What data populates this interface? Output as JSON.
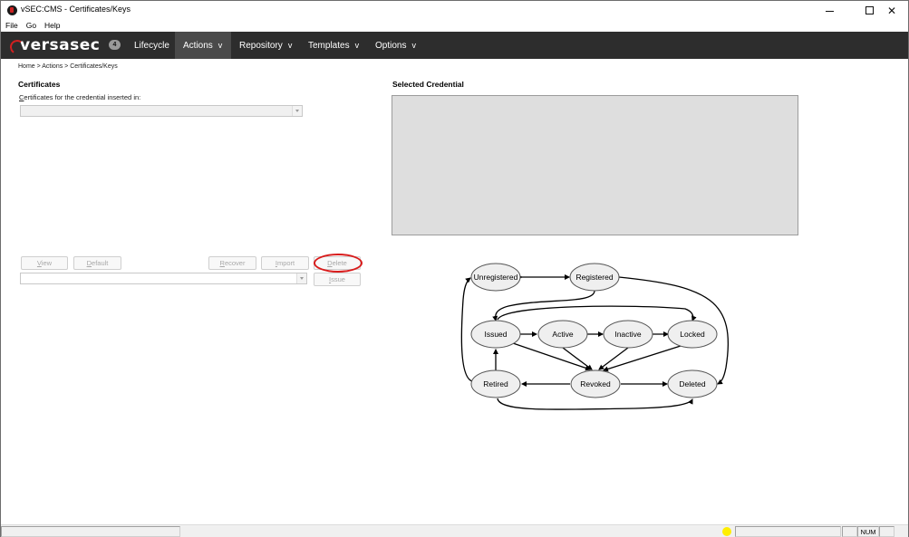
{
  "window": {
    "title": "vSEC:CMS - Certificates/Keys"
  },
  "menubar": {
    "items": [
      {
        "label": "File"
      },
      {
        "label": "Go"
      },
      {
        "label": "Help"
      }
    ]
  },
  "navbar": {
    "brand": "versasec",
    "badge_count": "4",
    "items": [
      {
        "label": "Lifecycle",
        "chevron": ""
      },
      {
        "label": "Actions",
        "chevron": "v"
      },
      {
        "label": "Repository",
        "chevron": "v"
      },
      {
        "label": "Templates",
        "chevron": "v"
      },
      {
        "label": "Options",
        "chevron": "v"
      }
    ],
    "active_item": "Actions"
  },
  "breadcrumb": "Home > Actions > Certificates/Keys",
  "certificates": {
    "heading": "Certificates",
    "field_label_accel": "C",
    "field_label_rest": "ertificates for the credential inserted in:",
    "credential_select_value": "",
    "key_select_value": ""
  },
  "buttons": {
    "view": {
      "accel": "V",
      "rest": "iew"
    },
    "default": {
      "accel": "D",
      "rest": "efault"
    },
    "recover": {
      "accel": "R",
      "rest": "ecover"
    },
    "import": {
      "accel": "I",
      "rest": "mport"
    },
    "delete": {
      "accel": "D",
      "rest": "elete"
    },
    "issue": {
      "accel": "I",
      "rest": "ssue"
    }
  },
  "selected_credential": {
    "heading": "Selected Credential"
  },
  "lifecycle_diagram": {
    "states": [
      "Unregistered",
      "Registered",
      "Issued",
      "Active",
      "Inactive",
      "Locked",
      "Retired",
      "Revoked",
      "Deleted"
    ]
  },
  "statusbar": {
    "num_indicator": "NUM",
    "indicator_color": "#ffee00"
  },
  "colors": {
    "navbar_bg": "#2d2d2d",
    "navbar_active_bg": "#4a4a4a",
    "brand_accent": "#d32020",
    "highlight_ring": "#d81b1b"
  }
}
